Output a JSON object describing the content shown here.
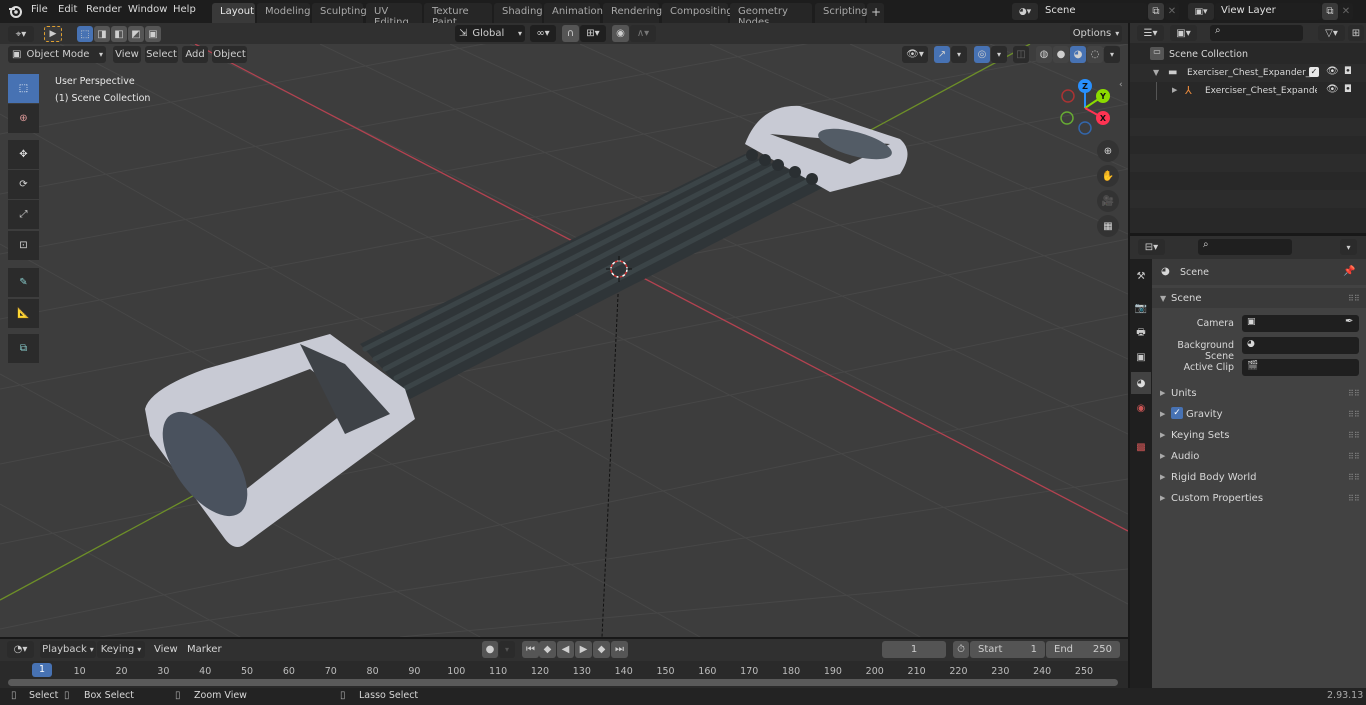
{
  "topbar": {
    "menus": [
      "File",
      "Edit",
      "Render",
      "Window",
      "Help"
    ],
    "workspaces": [
      "Layout",
      "Modeling",
      "Sculpting",
      "UV Editing",
      "Texture Paint",
      "Shading",
      "Animation",
      "Rendering",
      "Compositing",
      "Geometry Nodes",
      "Scripting"
    ],
    "active_workspace": "Layout",
    "add_workspace": "+",
    "scene_name": "Scene",
    "view_layer_name": "View Layer"
  },
  "header3d": {
    "transform_orientation": "Global",
    "options_label": "Options",
    "mode": "Object Mode",
    "menus": [
      "View",
      "Select",
      "Add",
      "Object"
    ]
  },
  "viewport": {
    "perspective_label": "User Perspective",
    "collection_label": "(1) Scene Collection",
    "gizmo_axes": {
      "x": "X",
      "y": "Y",
      "z": "Z"
    },
    "axis_colors": {
      "x": "#ff3352",
      "y": "#8bdc00",
      "z": "#2890ff"
    },
    "tools": [
      "select-box",
      "cursor",
      "move",
      "rotate",
      "scale",
      "transform",
      "annotate",
      "measure",
      "add-cube"
    ]
  },
  "outliner": {
    "search_placeholder": "",
    "root": "Scene Collection",
    "items": [
      {
        "label": "Exerciser_Chest_Expander_Bl",
        "type": "collection",
        "checked": true
      },
      {
        "label": "Exerciser_Chest_Expande",
        "type": "object"
      }
    ]
  },
  "properties": {
    "search_placeholder": "",
    "context": "Scene",
    "panel_title": "Scene",
    "fields": [
      {
        "label": "Camera",
        "value": ""
      },
      {
        "label": "Background Scene",
        "value": ""
      },
      {
        "label": "Active Clip",
        "value": ""
      }
    ],
    "subpanels": [
      {
        "label": "Units"
      },
      {
        "label": "Gravity",
        "checkbox": true
      },
      {
        "label": "Keying Sets"
      },
      {
        "label": "Audio"
      },
      {
        "label": "Rigid Body World"
      },
      {
        "label": "Custom Properties"
      }
    ]
  },
  "timeline": {
    "menus": [
      "Playback",
      "Keying",
      "View",
      "Marker"
    ],
    "current_frame": "1",
    "start_label": "Start",
    "start_value": "1",
    "end_label": "End",
    "end_value": "250",
    "playhead_frame": "1",
    "ticks": [
      "10",
      "20",
      "30",
      "40",
      "50",
      "60",
      "70",
      "80",
      "90",
      "100",
      "110",
      "120",
      "130",
      "140",
      "150",
      "160",
      "170",
      "180",
      "190",
      "200",
      "210",
      "220",
      "230",
      "240",
      "250"
    ]
  },
  "statusbar": {
    "hints": [
      "Select",
      "Box Select",
      "Zoom View",
      "Lasso Select"
    ],
    "version": "2.93.13"
  }
}
